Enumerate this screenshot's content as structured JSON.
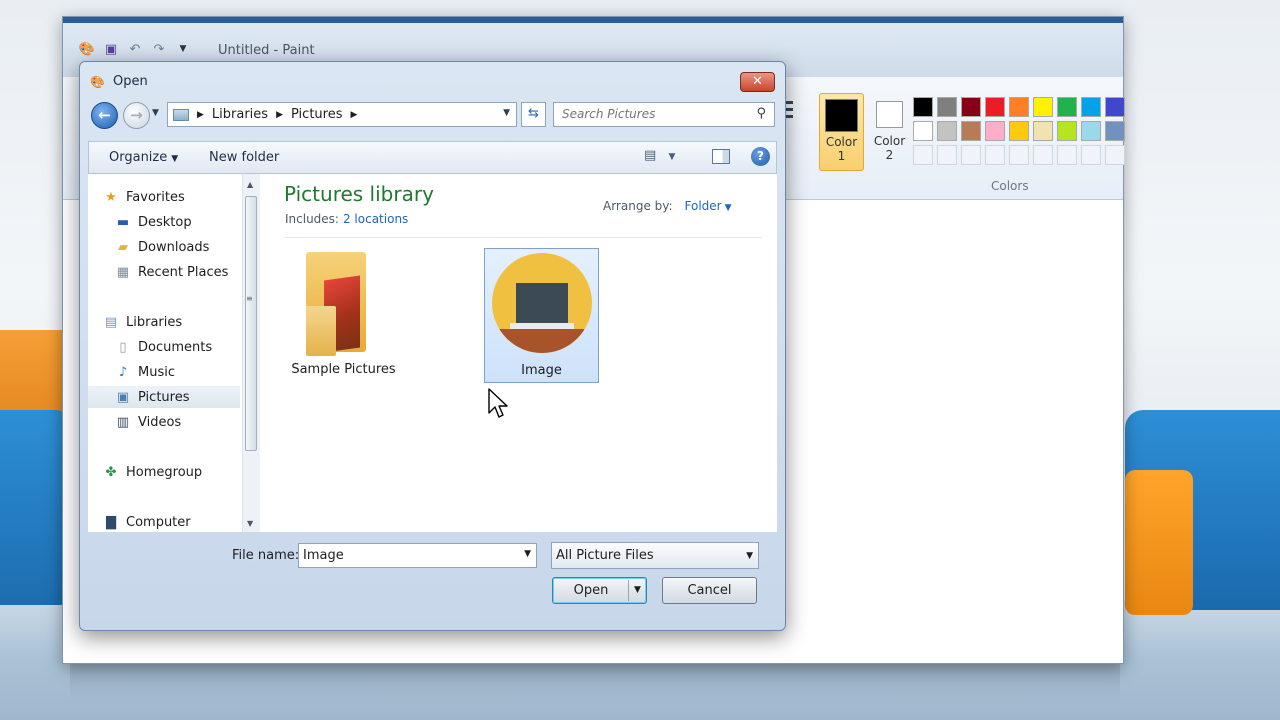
{
  "paint": {
    "title": "Untitled - Paint",
    "color1_label_line1": "Color",
    "color1_label_line2": "1",
    "color2_label_line1": "Color",
    "color2_label_line2": "2",
    "colors_group_label": "Colors",
    "palette": [
      "#000000",
      "#7f7f7f",
      "#880015",
      "#ed1c24",
      "#ff7f27",
      "#fff200",
      "#22b14c",
      "#00a2e8",
      "#3f48cc",
      "#ffffff",
      "#c3c3c3",
      "#b97a57",
      "#ffaec9",
      "#ffc90e",
      "#efe4b0",
      "#b5e61d",
      "#99d9ea",
      "#7092be"
    ]
  },
  "dialog": {
    "title": "Open",
    "close_glyph": "✕",
    "breadcrumb": [
      "Libraries",
      "Pictures"
    ],
    "search_placeholder": "Search Pictures",
    "toolbar": {
      "organize_label": "Organize",
      "new_folder_label": "New folder",
      "help_glyph": "?"
    },
    "nav": {
      "favorites": "Favorites",
      "desktop": "Desktop",
      "downloads": "Downloads",
      "recent_places": "Recent Places",
      "libraries": "Libraries",
      "documents": "Documents",
      "music": "Music",
      "pictures": "Pictures",
      "videos": "Videos",
      "homegroup": "Homegroup",
      "computer": "Computer",
      "selected": "Pictures"
    },
    "content": {
      "library_title": "Pictures library",
      "includes_label": "Includes:",
      "includes_link": "2 locations",
      "arrange_label": "Arrange by:",
      "arrange_value": "Folder",
      "items": [
        {
          "name": "Sample Pictures",
          "type": "folder",
          "selected": false
        },
        {
          "name": "Image",
          "type": "image",
          "selected": true
        }
      ]
    },
    "file_name_label": "File name:",
    "file_name_value": "Image",
    "file_type_value": "All Picture Files",
    "open_button": "Open",
    "cancel_button": "Cancel"
  },
  "icons": {
    "back": "arrow-left-icon",
    "forward": "arrow-right-icon",
    "refresh": "refresh-icon",
    "search": "search-icon",
    "help": "help-icon",
    "close": "close-icon"
  },
  "colors": {
    "paint_accent": "#2c5d9b",
    "library_title": "#1f7a2f",
    "link": "#1d67c4",
    "close_button": "#c9452b"
  }
}
